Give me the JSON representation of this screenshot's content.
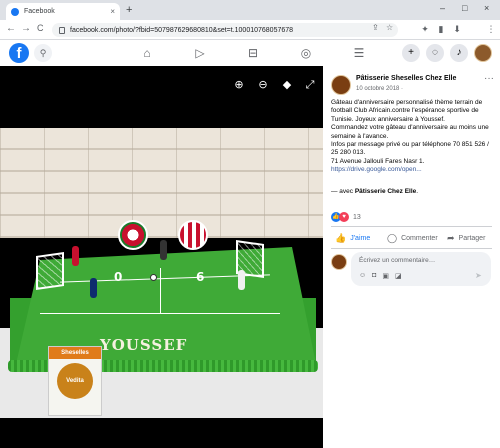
{
  "browser": {
    "tab_title": "Facebook",
    "tab_close": "×",
    "new_tab": "+",
    "window_controls": [
      "–",
      "□",
      "×"
    ],
    "url": "facebook.com/photo/?fbid=507987629680810&set=t.100010768057678",
    "nav": [
      "←",
      "→",
      "C"
    ]
  },
  "facebook": {
    "logo": "f",
    "nav_icons": [
      "home-icon",
      "watch-icon",
      "marketplace-icon",
      "groups-icon",
      "menu-icon"
    ],
    "right_icons": [
      "create-icon",
      "messenger-icon",
      "notifications-icon",
      "account-icon"
    ]
  },
  "photo": {
    "cake_text": "YOUSSEF",
    "score_left": "0",
    "score_right": "6",
    "flour_brand": "Vedita",
    "flour_top": "Sheselles",
    "viewer_controls": [
      "zoom-in-icon",
      "zoom-out-icon",
      "tag-icon",
      "fullscreen-icon"
    ]
  },
  "post": {
    "page_name": "Pâtisserie Sheselles Chez Elle",
    "date": "10 octobre 2018 ·",
    "more": "···",
    "lines": [
      "Gâteau d'anniversaire personnalisé thème terrain de football Club Africain.contre l'espérance sportive de Tunisie. Joyeux anniversaire à Youssef.",
      "Commandez votre gâteau d'anniversaire au moins une semaine à l'avance.",
      "Infos par message privé ou par téléphone 70 851 526 / 25 280 013.",
      "71 Avenue Jallouli Fares Nasr 1."
    ],
    "link": "https://drive.google.com/open...",
    "with_prefix": "— avec ",
    "with_name": "Pâtisserie Chez Elle",
    "with_suffix": ".",
    "reaction_count": "13",
    "actions": {
      "like": "J'aime",
      "comment": "Commenter",
      "share": "Partager"
    },
    "comment_placeholder": "Écrivez un commentaire…"
  },
  "colors": {
    "facebook_blue": "#1877f2",
    "love_red": "#f33e58",
    "cake_green": "#3faa37"
  }
}
